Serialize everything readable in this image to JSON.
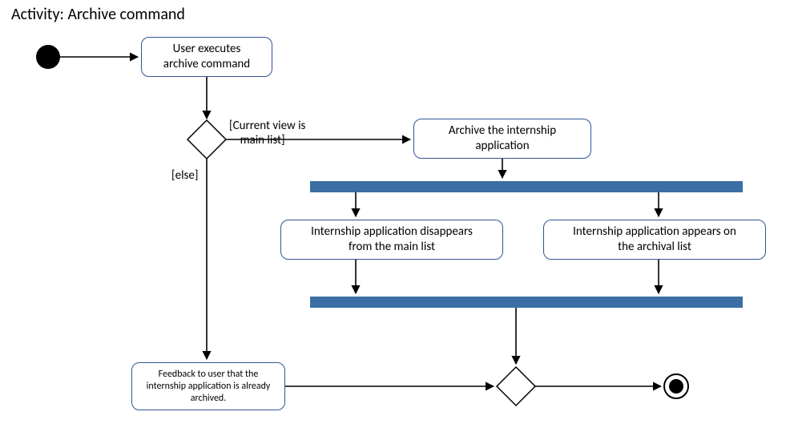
{
  "title": "Activity: Archive command",
  "nodes": {
    "start_label": "User executes\narchive command",
    "archive_action": "Archive the internship\napplication",
    "disappear": "Internship application disappears\nfrom the main list",
    "appear": "Internship application appears on\nthe archival list",
    "feedback": "Feedback to user that the\ninternship application is already\narchived."
  },
  "guards": {
    "main_list": "[Current view is\n    main list]",
    "else": "[else]"
  }
}
